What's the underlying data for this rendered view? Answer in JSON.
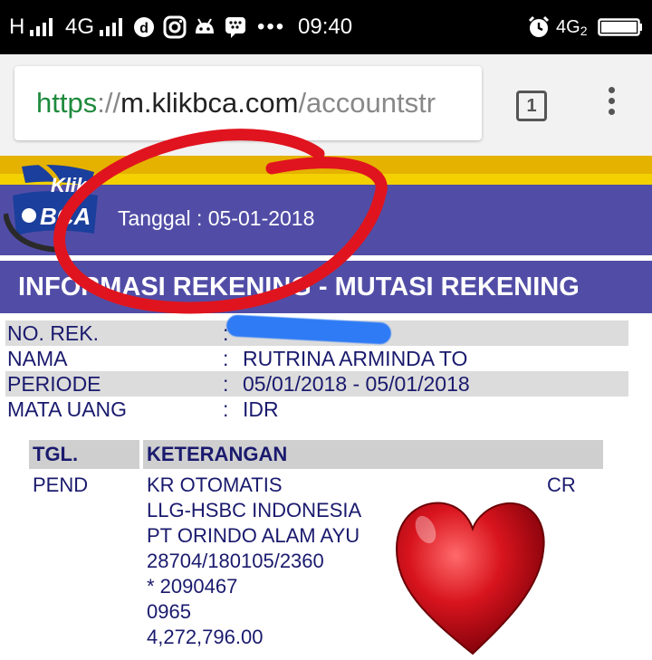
{
  "status_bar": {
    "network_left": "H",
    "network_type": "4G",
    "time": "09:40",
    "network_right": "4G",
    "network_right_sub": "2",
    "dots": "•••"
  },
  "browser": {
    "url_scheme": "https",
    "url_sep": "://",
    "url_host": "m.klikbca.com",
    "url_path": "/accountstr",
    "tab_count": "1"
  },
  "bank": {
    "logo_top": "Klik",
    "logo_bottom": "BCA",
    "date_line": "Tanggal : 05-01-2018",
    "title": "INFORMASI REKENING - MUTASI REKENING"
  },
  "account_info": [
    {
      "label": "NO. REK.",
      "colon": ":",
      "value": ""
    },
    {
      "label": "NAMA",
      "colon": ":",
      "value": "RUTRINA ARMINDA TO"
    },
    {
      "label": "PERIODE",
      "colon": ":",
      "value": "05/01/2018 - 05/01/2018"
    },
    {
      "label": "MATA UANG",
      "colon": ":",
      "value": "IDR"
    }
  ],
  "transactions": {
    "headers": {
      "date": "TGL.",
      "desc": "KETERANGAN"
    },
    "rows": [
      {
        "date": "PEND",
        "desc": [
          "KR OTOMATIS",
          "LLG-HSBC INDONESIA",
          "PT ORINDO ALAM AYU",
          "28704/180105/2360",
          "* 2090467",
          "0965",
          "4,272,796.00"
        ],
        "type": "CR"
      }
    ]
  },
  "colors": {
    "header_blue": "#514da6",
    "gold": "#e5b200",
    "annotation_red": "#e0141e",
    "heart_red": "#c4101a"
  }
}
